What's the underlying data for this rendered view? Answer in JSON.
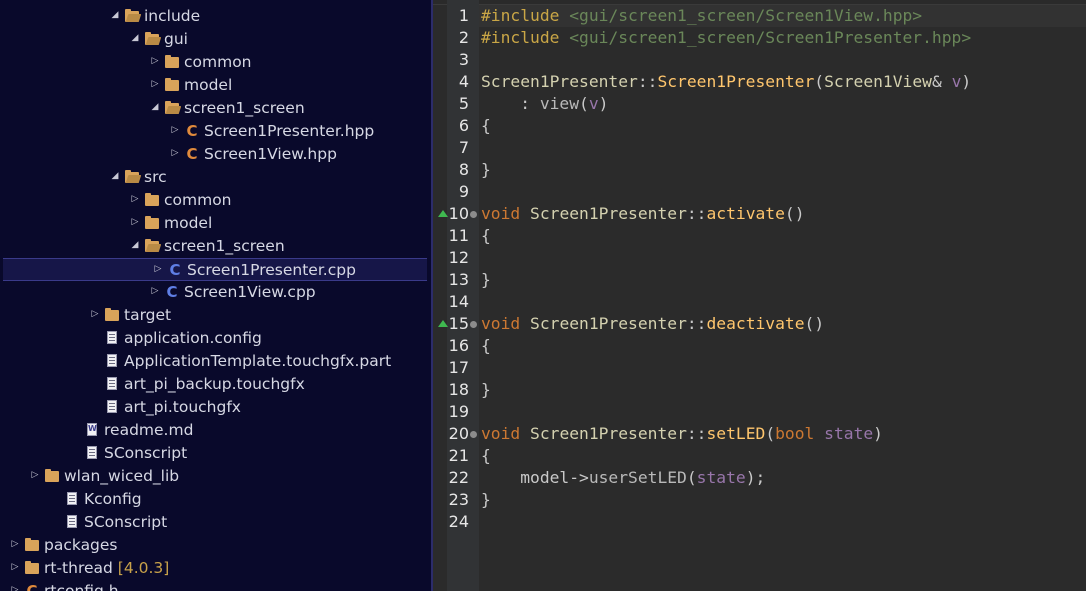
{
  "tree": {
    "rows": [
      {
        "name": "include",
        "icon": "folder-open-icon",
        "twist": "open"
      },
      {
        "name": "gui",
        "icon": "folder-open-icon",
        "twist": "open"
      },
      {
        "name": "common",
        "icon": "folder-icon",
        "twist": "closed"
      },
      {
        "name": "model",
        "icon": "folder-icon",
        "twist": "closed"
      },
      {
        "name": "screen1_screen",
        "icon": "folder-open-icon",
        "twist": "open"
      },
      {
        "name": "Screen1Presenter.hpp",
        "icon": "c-header-file-icon",
        "twist": "closed"
      },
      {
        "name": "Screen1View.hpp",
        "icon": "c-header-file-icon",
        "twist": "closed"
      },
      {
        "name": "src",
        "icon": "folder-open-icon",
        "twist": "open"
      },
      {
        "name": "common",
        "icon": "folder-icon",
        "twist": "closed"
      },
      {
        "name": "model",
        "icon": "folder-icon",
        "twist": "closed"
      },
      {
        "name": "screen1_screen",
        "icon": "folder-open-icon",
        "twist": "open"
      },
      {
        "name": "Screen1Presenter.cpp",
        "icon": "c-source-file-icon",
        "twist": "closed",
        "selected": true
      },
      {
        "name": "Screen1View.cpp",
        "icon": "c-source-file-icon",
        "twist": "closed"
      },
      {
        "name": "target",
        "icon": "folder-icon",
        "twist": "closed"
      },
      {
        "name": "application.config",
        "icon": "text-file-icon"
      },
      {
        "name": "ApplicationTemplate.touchgfx.part",
        "icon": "text-file-icon"
      },
      {
        "name": "art_pi_backup.touchgfx",
        "icon": "text-file-icon"
      },
      {
        "name": "art_pi.touchgfx",
        "icon": "text-file-icon"
      },
      {
        "name": "readme.md",
        "icon": "word-file-icon"
      },
      {
        "name": "SConscript",
        "icon": "text-file-icon"
      },
      {
        "name": "wlan_wiced_lib",
        "icon": "folder-icon",
        "twist": "closed"
      },
      {
        "name": "Kconfig",
        "icon": "text-file-icon"
      },
      {
        "name": "SConscript",
        "icon": "text-file-icon"
      },
      {
        "name": "packages",
        "icon": "folder-icon",
        "twist": "closed"
      },
      {
        "name": "rt-thread",
        "icon": "folder-icon",
        "twist": "closed",
        "version": "[4.0.3]"
      },
      {
        "name": "rtconfig.h",
        "icon": "c-header-file-icon",
        "twist": "closed"
      }
    ]
  },
  "editor": {
    "line_numbers": [
      "1",
      "2",
      "3",
      "4",
      "5",
      "6",
      "7",
      "8",
      "9",
      "10",
      "11",
      "12",
      "13",
      "14",
      "15",
      "16",
      "17",
      "18",
      "19",
      "20",
      "21",
      "22",
      "23",
      "24"
    ],
    "override_markers": [
      "10",
      "15"
    ],
    "fold_markers": [
      "10",
      "15",
      "20"
    ],
    "tokens": {
      "include": "#include",
      "path1": "<gui/screen1_screen/Screen1View.hpp>",
      "path2": "<gui/screen1_screen/Screen1Presenter.hpp>",
      "ctor_class": "Screen1Presenter",
      "scope": "::",
      "ctor_name": "Screen1Presenter",
      "param_type": "Screen1View",
      "amp": "&",
      "param_v": "v",
      "init_colon": "    : ",
      "view_fn": "view",
      "void_kw": "void",
      "class_name": "Screen1Presenter",
      "activate": "activate",
      "deactivate": "deactivate",
      "setLED": "setLED",
      "bool_kw": "bool",
      "state": "state",
      "model": "    model->",
      "userSetLED": "userSetLED",
      "open_brace": "{",
      "close_brace": "}",
      "empty_parens": "()",
      "open_paren": "(",
      "close_paren": ")",
      "close_paren_semi": ");",
      "space": " "
    }
  }
}
